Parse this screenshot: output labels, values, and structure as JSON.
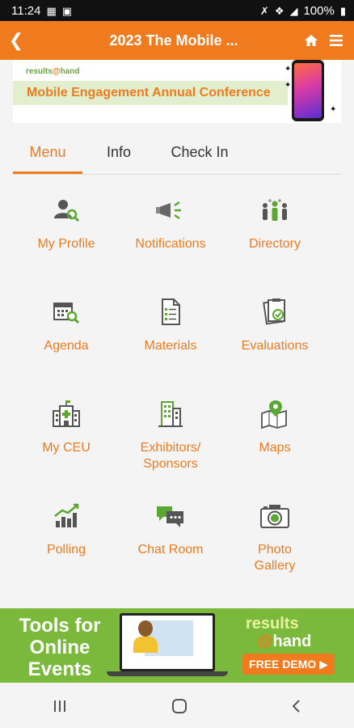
{
  "status_bar": {
    "time": "11:24",
    "battery": "100%",
    "left_icons": [
      "image-notification-icon",
      "gallery-notification-icon"
    ],
    "right_icons": [
      "mute-icon",
      "bluetooth-icon",
      "signal-icon",
      "battery-icon"
    ]
  },
  "app_bar": {
    "back_icon": "chevron-left-icon",
    "title": "2023 The Mobile ...",
    "home_icon": "home-icon",
    "menu_icon": "hamburger-menu-icon",
    "color": "#f07a1e"
  },
  "banner": {
    "logo_part1": "results",
    "logo_at": "@",
    "logo_part2": "hand",
    "headline": "Mobile Engagement Annual Conference"
  },
  "tabs": [
    {
      "label": "Menu",
      "active": true
    },
    {
      "label": "Info",
      "active": false
    },
    {
      "label": "Check In",
      "active": false
    }
  ],
  "menu": [
    {
      "label": "My Profile",
      "icon": "profile-search-icon"
    },
    {
      "label": "Notifications",
      "icon": "megaphone-icon"
    },
    {
      "label": "Directory",
      "icon": "people-group-icon"
    },
    {
      "label": "Agenda",
      "icon": "calendar-search-icon"
    },
    {
      "label": "Materials",
      "icon": "document-icon"
    },
    {
      "label": "Evaluations",
      "icon": "clipboard-check-icon"
    },
    {
      "label": "My CEU",
      "icon": "hospital-icon"
    },
    {
      "label": "Exhibitors/\nSponsors",
      "icon": "building-icon"
    },
    {
      "label": "Maps",
      "icon": "map-pin-icon"
    },
    {
      "label": "Polling",
      "icon": "bar-chart-icon"
    },
    {
      "label": "Chat Room",
      "icon": "chat-bubbles-icon"
    },
    {
      "label": "Photo\nGallery",
      "icon": "camera-icon"
    }
  ],
  "ad": {
    "left_text": "Tools for Online Events",
    "brand_line1": "results",
    "brand_at": "@",
    "brand_line2": "hand",
    "cta": "FREE DEMO",
    "background": "#7bb93c"
  },
  "nav_bar": {
    "recent_icon": "recent-apps-icon",
    "home_icon": "home-circle-icon",
    "back_icon": "back-chevron-icon"
  }
}
